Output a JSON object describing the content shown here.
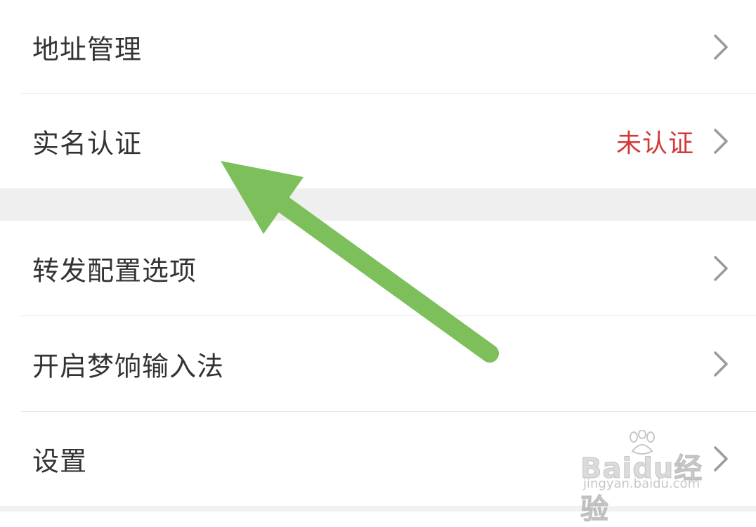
{
  "menu": {
    "items": [
      {
        "label": "地址管理"
      },
      {
        "label": "实名认证",
        "status": "未认证"
      },
      {
        "label": "转发配置选项"
      },
      {
        "label": "开启梦饷输入法"
      },
      {
        "label": "设置"
      }
    ]
  },
  "watermark": {
    "logo_text": "Baidu经验",
    "url": "jingyan.baidu.com"
  },
  "colors": {
    "status_red": "#d23a3a",
    "arrow_green": "#7dbf5a",
    "section_gap": "#efefef"
  },
  "icons": [
    "chevron-right-icon",
    "annotation-arrow-icon",
    "baidu-paw-icon"
  ]
}
